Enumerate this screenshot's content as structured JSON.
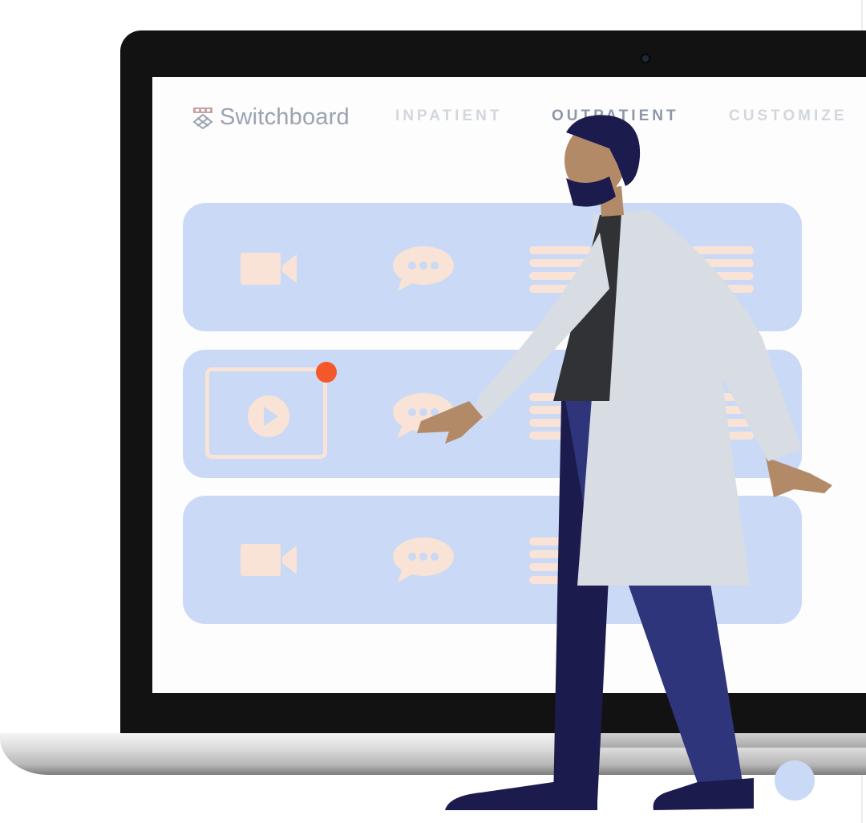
{
  "app": {
    "brand_name": "Switchboard",
    "brand_icon": "university-shield-icon"
  },
  "nav": {
    "items": [
      {
        "label": "INPATIENT",
        "active": false
      },
      {
        "label": "OUTPATIENT",
        "active": true
      },
      {
        "label": "CUSTOMIZE",
        "active": false
      }
    ]
  },
  "cards": [
    {
      "icons": [
        "video-camera-icon",
        "chat-bubble-icon",
        "list-icon"
      ]
    },
    {
      "icons": [
        "play-video-icon",
        "chat-bubble-icon",
        "list-icon"
      ],
      "notification": true
    },
    {
      "icons": [
        "video-camera-icon",
        "chat-bubble-icon",
        "list-icon"
      ]
    }
  ],
  "colors": {
    "card_bg": "#cad9f5",
    "icon_fill": "#f9e3d6",
    "notification": "#f4582a",
    "laptop_bezel": "#121212",
    "brand_text": "#9aa3b2",
    "nav_text": "#d2d6de",
    "doctor_coat": "#d7dde3",
    "doctor_pants": "#1c1b4d",
    "doctor_skin": "#b38a68",
    "doctor_shirt": "#303236"
  }
}
